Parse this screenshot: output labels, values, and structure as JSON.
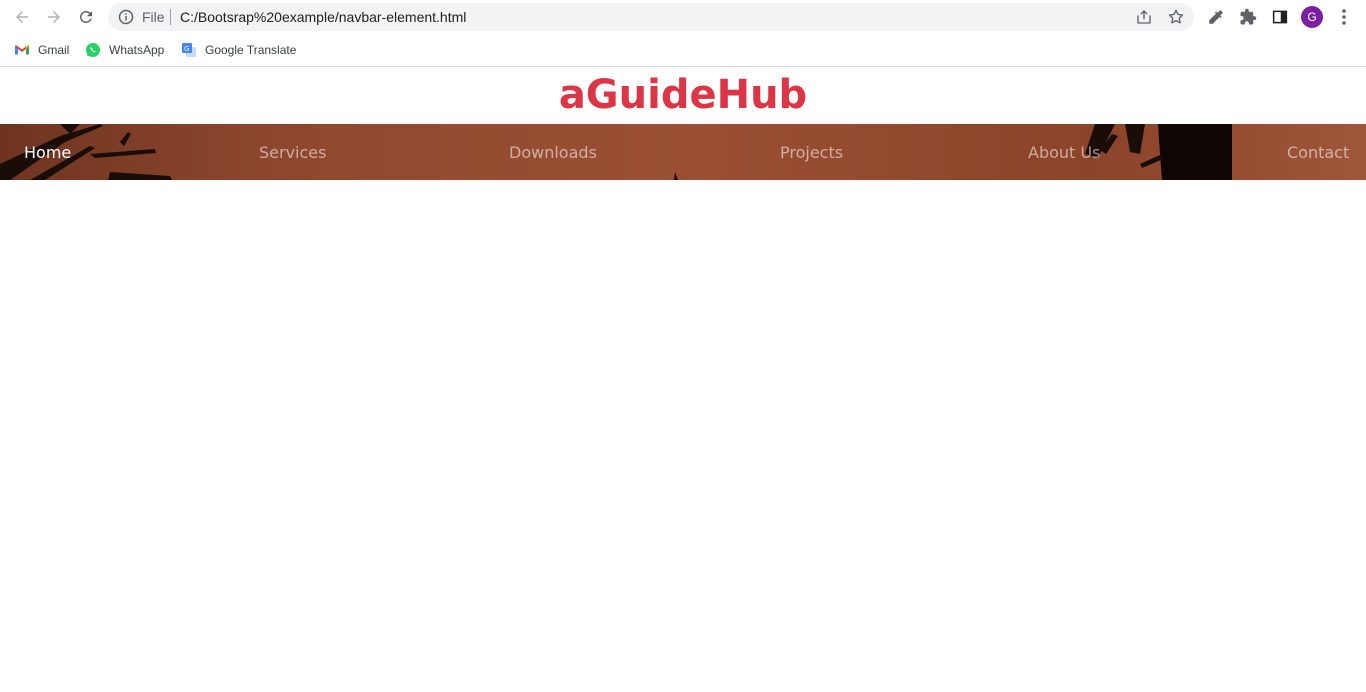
{
  "browser": {
    "file_label": "File",
    "url": "C:/Bootsrap%20example/navbar-element.html",
    "profile_initial": "G",
    "profile_color": "#7b1fa2"
  },
  "bookmarks": [
    {
      "label": "Gmail",
      "icon": "gmail-icon"
    },
    {
      "label": "WhatsApp",
      "icon": "whatsapp-icon"
    },
    {
      "label": "Google Translate",
      "icon": "google-translate-icon"
    }
  ],
  "page": {
    "title": "aGuideHub",
    "title_color": "#dc3545",
    "nav": [
      {
        "label": "Home",
        "active": true
      },
      {
        "label": "Services",
        "active": false
      },
      {
        "label": "Downloads",
        "active": false
      },
      {
        "label": "Projects",
        "active": false
      },
      {
        "label": "About Us",
        "active": false
      },
      {
        "label": "Contact",
        "active": false
      }
    ]
  }
}
